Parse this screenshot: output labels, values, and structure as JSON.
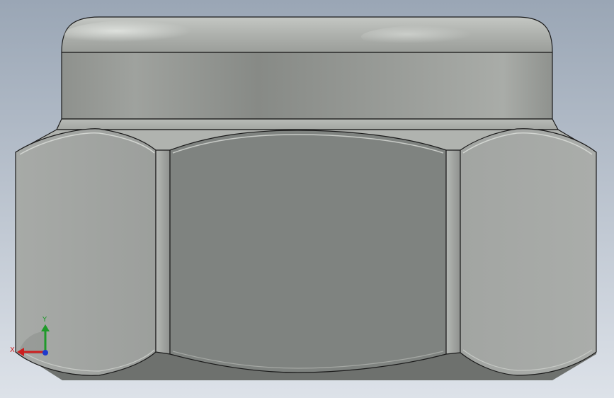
{
  "viewport": {
    "background_top": "#9aa6b5",
    "background_bottom": "#dde2e9"
  },
  "part": {
    "name": "hex-nylon-insert-lock-nut",
    "outline_color": "#1a1a1a",
    "cap_color": "#9a9d99",
    "center_face_color": "#7f8380",
    "side_face_color": "#a2a5a2",
    "bottom_shadow_color": "#6e716e"
  },
  "triad": {
    "x_label": "X",
    "y_label": "Y",
    "x_color": "#cc1f1f",
    "y_color": "#1f9a2a",
    "z_color": "#1f3acc"
  }
}
